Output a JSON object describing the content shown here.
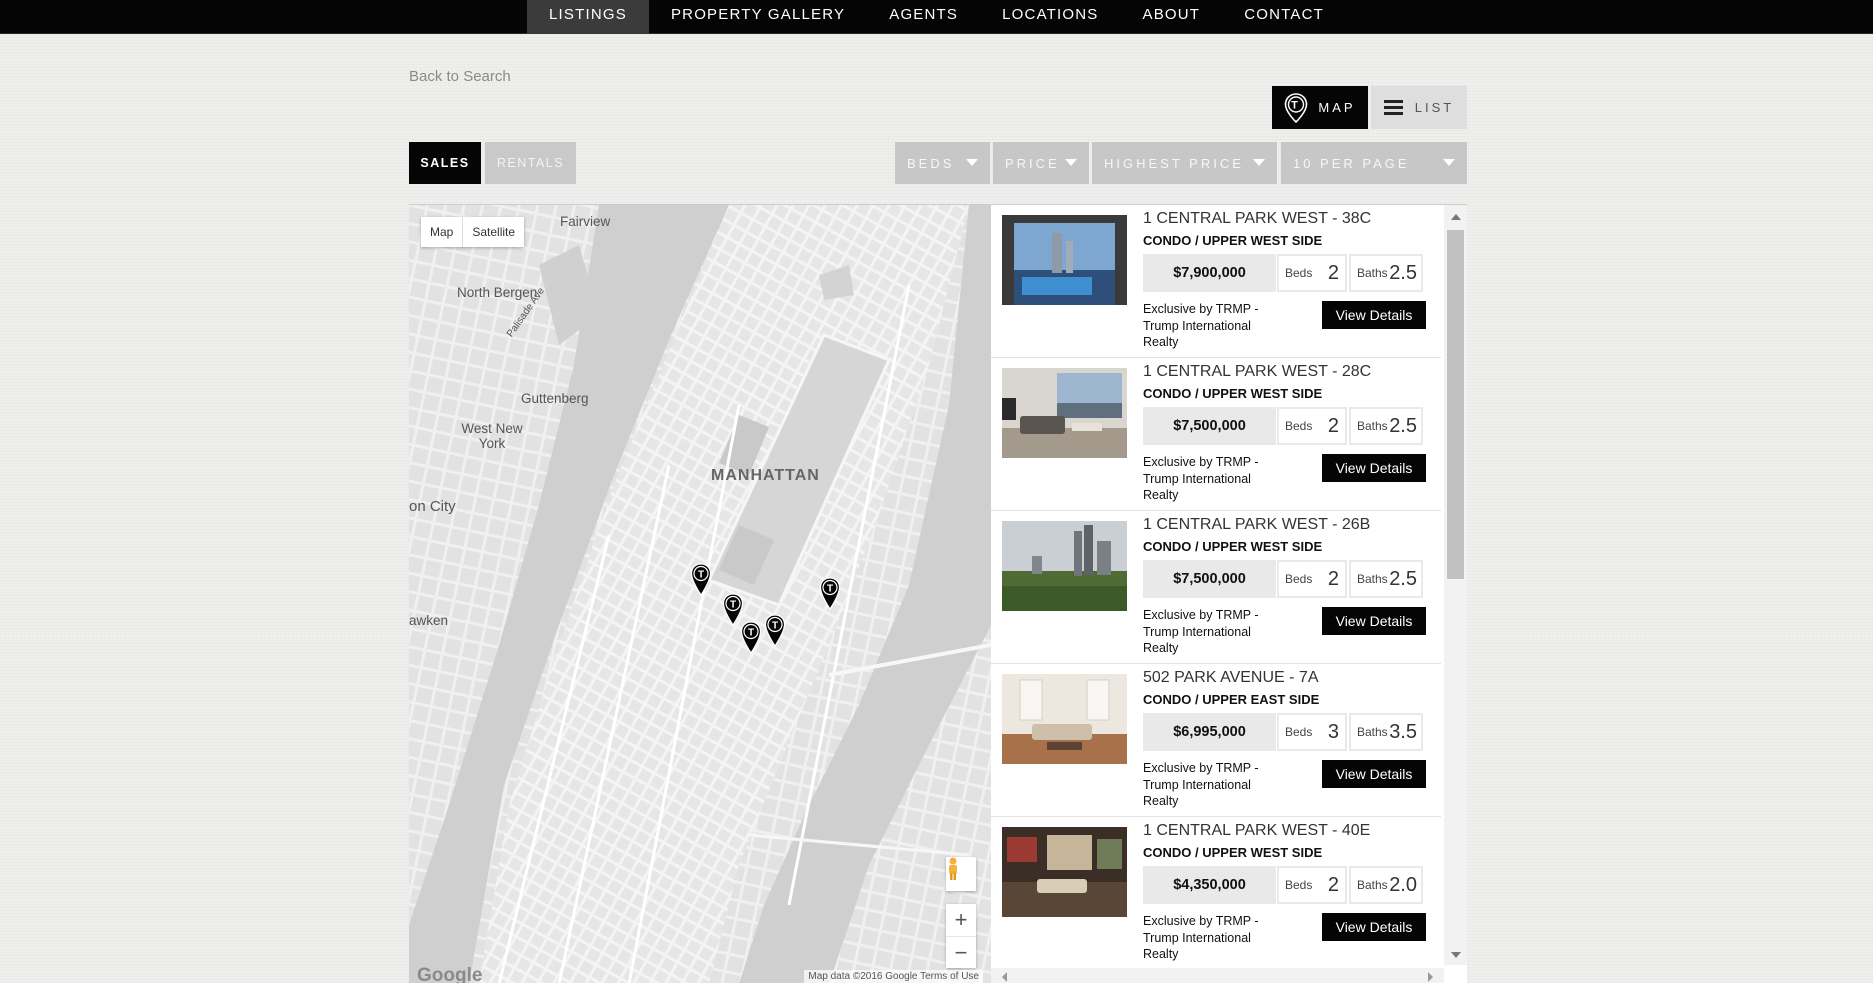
{
  "nav": {
    "items": [
      "LISTINGS",
      "PROPERTY GALLERY",
      "AGENTS",
      "LOCATIONS",
      "ABOUT",
      "CONTACT"
    ],
    "active": "LISTINGS"
  },
  "back_link": "Back to Search",
  "view_toggle": {
    "map_label": "MAP",
    "list_label": "LIST",
    "active": "MAP"
  },
  "tabs": {
    "sales": "SALES",
    "rentals": "RENTALS",
    "active": "SALES"
  },
  "filters": {
    "beds": "BEDS",
    "price": "PRICE",
    "sort": "HIGHEST PRICE",
    "per_page": "10 PER PAGE"
  },
  "map": {
    "type_controls": {
      "map": "Map",
      "satellite": "Satellite"
    },
    "labels": {
      "fairview": "Fairview",
      "north_bergen": "North Bergen",
      "palisade_ave": "Palisade Ave",
      "guttenberg": "Guttenberg",
      "west_new_york": "West New York",
      "manhattan": "MANHATTAN",
      "union_city": "on City",
      "weehawken": "awken"
    },
    "zoom_in": "+",
    "zoom_out": "−",
    "logo": "Google",
    "attribution": "Map data ©2016 Google    Terms of Use",
    "pin_glyph": "T",
    "marker_count": 5
  },
  "listings": [
    {
      "title": "1 CENTRAL PARK WEST - 38C",
      "subtitle": "CONDO / UPPER WEST SIDE",
      "price": "$7,900,000",
      "beds_label": "Beds",
      "beds": "2",
      "baths_label": "Baths",
      "baths": "2.5",
      "agent": "Exclusive by TRMP - Trump International Realty",
      "button": "View Details",
      "thumb": "blue-pool-view"
    },
    {
      "title": "1 CENTRAL PARK WEST - 28C",
      "subtitle": "CONDO / UPPER WEST SIDE",
      "price": "$7,500,000",
      "beds_label": "Beds",
      "beds": "2",
      "baths_label": "Baths",
      "baths": "2.5",
      "agent": "Exclusive by TRMP - Trump International Realty",
      "button": "View Details",
      "thumb": "living-room"
    },
    {
      "title": "1 CENTRAL PARK WEST - 26B",
      "subtitle": "CONDO / UPPER WEST SIDE",
      "price": "$7,500,000",
      "beds_label": "Beds",
      "beds": "2",
      "baths_label": "Baths",
      "baths": "2.5",
      "agent": "Exclusive by TRMP - Trump International Realty",
      "button": "View Details",
      "thumb": "park-skyline"
    },
    {
      "title": "502 PARK AVENUE - 7A",
      "subtitle": "CONDO / UPPER EAST SIDE",
      "price": "$6,995,000",
      "beds_label": "Beds",
      "beds": "3",
      "baths_label": "Baths",
      "baths": "3.5",
      "agent": "Exclusive by TRMP - Trump International Realty",
      "button": "View Details",
      "thumb": "bright-living"
    },
    {
      "title": "1 CENTRAL PARK WEST - 40E",
      "subtitle": "CONDO / UPPER WEST SIDE",
      "price": "$4,350,000",
      "beds_label": "Beds",
      "beds": "2",
      "baths_label": "Baths",
      "baths": "2.0",
      "agent": "Exclusive by TRMP - Trump International Realty",
      "button": "View Details",
      "thumb": "dark-living"
    }
  ]
}
